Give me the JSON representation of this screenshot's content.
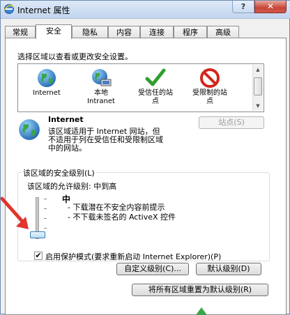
{
  "window": {
    "title": "Internet 属性",
    "help_label": "?",
    "close_label": "✕"
  },
  "tabs": [
    {
      "label": "常规",
      "active": false
    },
    {
      "label": "安全",
      "active": true
    },
    {
      "label": "隐私",
      "active": false
    },
    {
      "label": "内容",
      "active": false
    },
    {
      "label": "连接",
      "active": false
    },
    {
      "label": "程序",
      "active": false
    },
    {
      "label": "高级",
      "active": false
    }
  ],
  "security": {
    "instruction": "选择区域以查看或更改安全设置。",
    "zones": [
      {
        "label_line1": "Internet",
        "label_line2": "",
        "icon": "globe-icon"
      },
      {
        "label_line1": "本地",
        "label_line2": "Intranet",
        "icon": "intranet-globe-icon"
      },
      {
        "label_line1": "受信任的站",
        "label_line2": "点",
        "icon": "checkmark-icon"
      },
      {
        "label_line1": "受限制的站",
        "label_line2": "点",
        "icon": "restricted-icon"
      }
    ],
    "selected_zone": {
      "name": "Internet",
      "desc_line1": "该区域适用于 Internet 网站，但",
      "desc_line2": "不适用于列在受信任和受限制区域",
      "desc_line3": "中的网站。"
    },
    "sites_button": "站点(S)",
    "level_group_title": "该区域的安全级别(L)",
    "allowed_levels": "该区域的允许级别: 中到高",
    "level": {
      "name": "中",
      "bullet1": "- 下载潜在不安全内容前提示",
      "bullet2": "- 不下载未签名的 ActiveX 控件"
    },
    "protected_mode": {
      "label": "启用保护模式(要求重新启动 Internet Explorer)(P)",
      "checked": "✔"
    },
    "custom_level_button": "自定义级别(C)...",
    "default_level_button": "默认级别(D)",
    "reset_all_button": "将所有区域重置为默认级别(R)"
  },
  "colors": {
    "accent": "#3c7fb1",
    "annotation_arrow": "#e0342c"
  }
}
